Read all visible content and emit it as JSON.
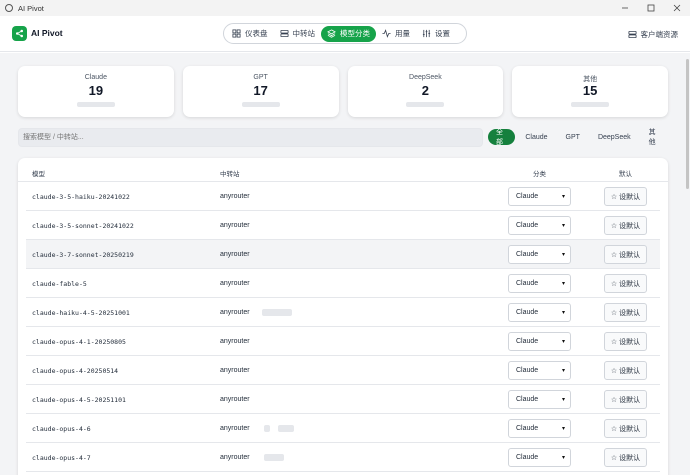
{
  "window": {
    "title": "AI Pivot"
  },
  "header": {
    "brand": "AI Pivot",
    "nav": [
      {
        "label": "仪表盘",
        "icon": "dashboard-icon",
        "active": false
      },
      {
        "label": "中转站",
        "icon": "server-icon",
        "active": false
      },
      {
        "label": "模型分类",
        "icon": "layers-icon",
        "active": true
      },
      {
        "label": "用量",
        "icon": "activity-icon",
        "active": false
      },
      {
        "label": "设置",
        "icon": "sliders-icon",
        "active": false
      }
    ],
    "client_resources": "客户端资源"
  },
  "stats": [
    {
      "label": "Claude",
      "value": "19"
    },
    {
      "label": "GPT",
      "value": "17"
    },
    {
      "label": "DeepSeek",
      "value": "2"
    },
    {
      "label": "其他",
      "value": "15"
    }
  ],
  "search": {
    "placeholder": "搜索模型 / 中转站..."
  },
  "filters": [
    {
      "label": "全部",
      "active": true
    },
    {
      "label": "Claude",
      "active": false
    },
    {
      "label": "GPT",
      "active": false
    },
    {
      "label": "DeepSeek",
      "active": false
    },
    {
      "label": "其他",
      "active": false
    }
  ],
  "table": {
    "headers": {
      "model": "模型",
      "relay": "中转站",
      "category": "分类",
      "default": "默认"
    },
    "set_default_label": "☆ 设默认",
    "rows": [
      {
        "model": "claude-3-5-haiku-20241022",
        "relay": "anyrouter",
        "category": "Claude"
      },
      {
        "model": "claude-3-5-sonnet-20241022",
        "relay": "anyrouter",
        "category": "Claude"
      },
      {
        "model": "claude-3-7-sonnet-20250219",
        "relay": "anyrouter",
        "category": "Claude"
      },
      {
        "model": "claude-fable-5",
        "relay": "anyrouter",
        "category": "Claude"
      },
      {
        "model": "claude-haiku-4-5-20251001",
        "relay": "anyrouter",
        "category": "Claude"
      },
      {
        "model": "claude-opus-4-1-20250805",
        "relay": "anyrouter",
        "category": "Claude"
      },
      {
        "model": "claude-opus-4-20250514",
        "relay": "anyrouter",
        "category": "Claude"
      },
      {
        "model": "claude-opus-4-5-20251101",
        "relay": "anyrouter",
        "category": "Claude"
      },
      {
        "model": "claude-opus-4-6",
        "relay": "anyrouter",
        "category": "Claude"
      },
      {
        "model": "claude-opus-4-7",
        "relay": "anyrouter",
        "category": "Claude"
      }
    ]
  }
}
